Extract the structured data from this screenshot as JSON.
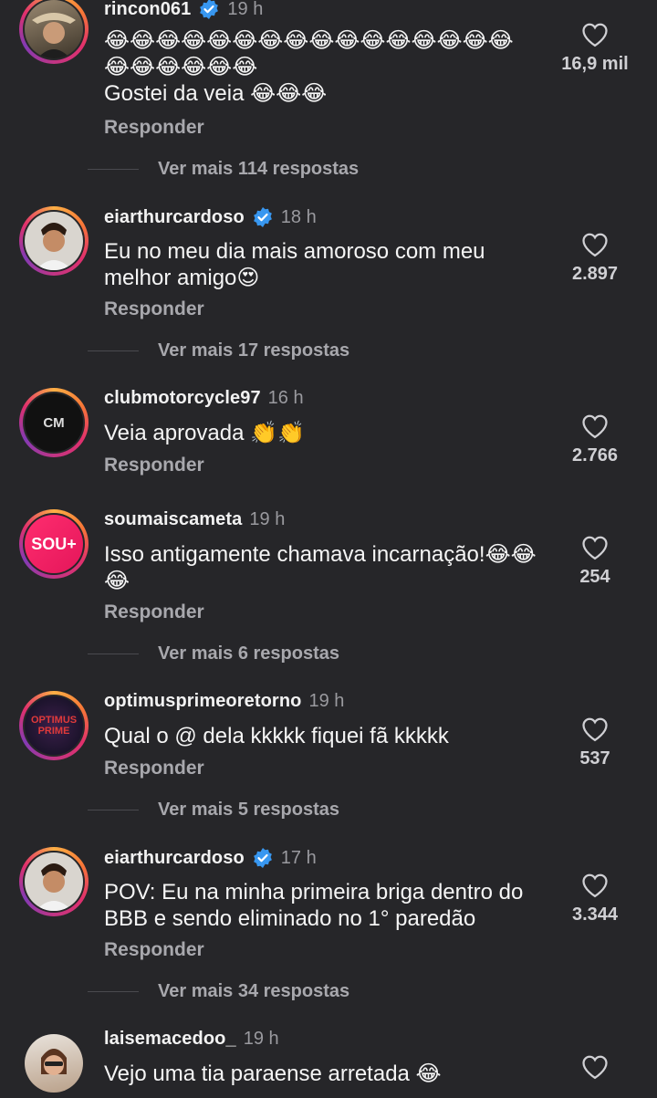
{
  "comments": [
    {
      "username": "rincon061",
      "verified": true,
      "time": "19 h",
      "text": "😂😂😂😂😂😂😂😂😂😂😂😂😂😂😂😂\n😂😂😂😂😂😂\nGostei da veia 😂😂😂",
      "reply_label": "Responder",
      "likes": "16,9 mil",
      "more_replies": "Ver mais 114 respostas"
    },
    {
      "username": "eiarthurcardoso",
      "verified": true,
      "time": "18 h",
      "text": "Eu no meu dia mais amoroso com meu melhor amigo😍",
      "reply_label": "Responder",
      "likes": "2.897",
      "more_replies": "Ver mais 17 respostas"
    },
    {
      "username": "clubmotorcycle97",
      "verified": false,
      "time": "16 h",
      "text": "Veia aprovada 👏👏",
      "reply_label": "Responder",
      "likes": "2.766",
      "avatar_text": "CM"
    },
    {
      "username": "soumaiscameta",
      "verified": false,
      "time": "19 h",
      "text": "Isso antigamente chamava incarnação!😂😂😂",
      "reply_label": "Responder",
      "likes": "254",
      "more_replies": "Ver mais 6 respostas",
      "avatar_text": "SOU+"
    },
    {
      "username": "optimusprimeoretorno",
      "verified": false,
      "time": "19 h",
      "text": "Qual o @ dela kkkkk fiquei fã kkkkk",
      "reply_label": "Responder",
      "likes": "537",
      "more_replies": "Ver mais 5 respostas",
      "avatar_text": "OPTIMUS PRIME"
    },
    {
      "username": "eiarthurcardoso",
      "verified": true,
      "time": "17 h",
      "text": "POV: Eu na minha primeira briga dentro do BBB e sendo eliminado no 1° paredão",
      "reply_label": "Responder",
      "likes": "3.344",
      "more_replies": "Ver mais 34 respostas"
    },
    {
      "username": "laisemacedoo_",
      "verified": false,
      "time": "19 h",
      "text": "Vejo uma tia paraense arretada 😂"
    }
  ],
  "colors": {
    "background": "#262629",
    "verified": "#3897f0",
    "ring": "#e1306c"
  }
}
